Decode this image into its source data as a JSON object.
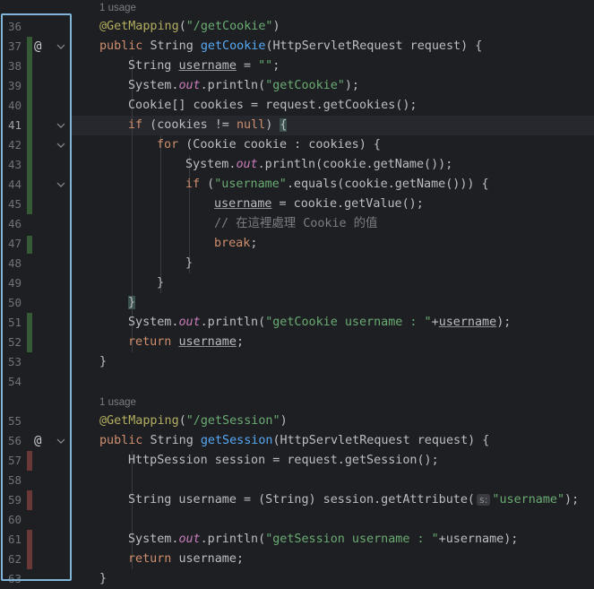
{
  "usage_hint": "1 usage",
  "param_hint": "s:",
  "colors": {
    "added": "#365a36",
    "removed": "#6b3838",
    "highlight_box": "#7fb6d9"
  },
  "line_numbers": [
    "36",
    "37",
    "38",
    "39",
    "40",
    "41",
    "42",
    "43",
    "44",
    "45",
    "46",
    "47",
    "48",
    "49",
    "50",
    "51",
    "52",
    "53",
    "54",
    "55",
    "56",
    "57",
    "58",
    "59",
    "60",
    "61",
    "62",
    "63"
  ],
  "code": {
    "l36_ann": "@GetMapping",
    "l36_p": "(",
    "l36_str": "\"/getCookie\"",
    "l36_e": ")",
    "l37_kw": "public ",
    "l37_t": "String ",
    "l37_fn": "getCookie",
    "l37_rest": "(HttpServletRequest request) {",
    "l38_a": "String ",
    "l38_var": "username",
    "l38_b": " = ",
    "l38_str": "\"\"",
    "l38_c": ";",
    "l39_a": "System.",
    "l39_out": "out",
    "l39_b": ".println(",
    "l39_str": "\"getCookie\"",
    "l39_c": ");",
    "l40": "Cookie[] cookies = request.getCookies();",
    "l41_kw": "if",
    "l41_a": " (cookies != ",
    "l41_null": "null",
    "l41_b": ") ",
    "l41_brace": "{",
    "l42_kw": "for",
    "l42_rest": " (Cookie cookie : cookies) {",
    "l43_a": "System.",
    "l43_out": "out",
    "l43_b": ".println(cookie.getName());",
    "l44_kw": "if",
    "l44_a": " (",
    "l44_str": "\"username\"",
    "l44_b": ".equals(cookie.getName())) {",
    "l45_var": "username",
    "l45_rest": " = cookie.getValue();",
    "l46_cmt": "// 在這裡處理 Cookie 的值",
    "l47_kw": "break",
    "l47_e": ";",
    "l48": "}",
    "l49": "}",
    "l50_brace": "}",
    "l51_a": "System.",
    "l51_out": "out",
    "l51_b": ".println(",
    "l51_str": "\"getCookie username : \"",
    "l51_c": "+",
    "l51_var": "username",
    "l51_d": ");",
    "l52_kw": "return ",
    "l52_var": "username",
    "l52_e": ";",
    "l53": "}",
    "l55_ann": "@GetMapping",
    "l55_p": "(",
    "l55_str": "\"/getSession\"",
    "l55_e": ")",
    "l56_kw": "public ",
    "l56_t": "String ",
    "l56_fn": "getSession",
    "l56_rest": "(HttpServletRequest request) {",
    "l57": "HttpSession session = request.getSession();",
    "l59_a": "String username = (String) session.getAttribute(",
    "l59_str": "\"username\"",
    "l59_b": ");",
    "l61_a": "System.",
    "l61_out": "out",
    "l61_b": ".println(",
    "l61_str": "\"getSession username : \"",
    "l61_c": "+username);",
    "l62_kw": "return ",
    "l62_rest": "username;",
    "l63": "}"
  }
}
